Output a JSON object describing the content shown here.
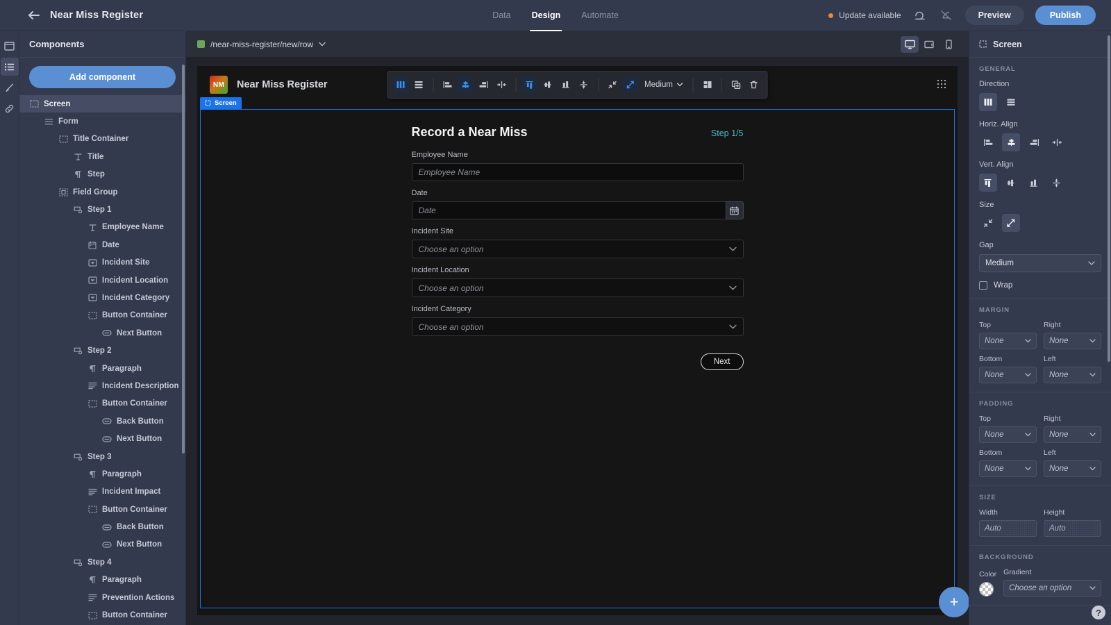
{
  "topbar": {
    "back_icon": "back-arrow-icon",
    "title": "Near Miss Register",
    "tabs": [
      {
        "label": "Data",
        "active": false
      },
      {
        "label": "Design",
        "active": true
      },
      {
        "label": "Automate",
        "active": false
      }
    ],
    "update_text": "Update available",
    "undo_icon": "undo-icon",
    "revert_icon": "revert-icon",
    "preview_label": "Preview",
    "publish_label": "Publish",
    "accent_blue": "#5b8fd4",
    "update_dot": "#e8883a"
  },
  "rail": {
    "items": [
      {
        "name": "screens-icon",
        "active": false
      },
      {
        "name": "components-list-icon",
        "active": true
      },
      {
        "name": "theme-brush-icon",
        "active": false
      },
      {
        "name": "bindings-link-icon",
        "active": false
      }
    ]
  },
  "left_panel": {
    "header": "Components",
    "add_button": "Add component",
    "tree": [
      {
        "label": "Screen",
        "depth": 0,
        "icon": "screen-icon",
        "selected": true
      },
      {
        "label": "Form",
        "depth": 1,
        "icon": "form-icon",
        "selected": false
      },
      {
        "label": "Title Container",
        "depth": 2,
        "icon": "container-icon",
        "selected": false
      },
      {
        "label": "Title",
        "depth": 3,
        "icon": "text-icon",
        "selected": false
      },
      {
        "label": "Step",
        "depth": 3,
        "icon": "paragraph-icon",
        "selected": false
      },
      {
        "label": "Field Group",
        "depth": 2,
        "icon": "field-group-icon",
        "selected": false
      },
      {
        "label": "Step 1",
        "depth": 3,
        "icon": "step-icon",
        "selected": false
      },
      {
        "label": "Employee Name",
        "depth": 4,
        "icon": "text-icon",
        "selected": false
      },
      {
        "label": "Date",
        "depth": 4,
        "icon": "date-icon",
        "selected": false
      },
      {
        "label": "Incident Site",
        "depth": 4,
        "icon": "select-icon",
        "selected": false
      },
      {
        "label": "Incident Location",
        "depth": 4,
        "icon": "select-icon",
        "selected": false
      },
      {
        "label": "Incident Category",
        "depth": 4,
        "icon": "select-icon",
        "selected": false
      },
      {
        "label": "Button Container",
        "depth": 4,
        "icon": "container-icon",
        "selected": false
      },
      {
        "label": "Next Button",
        "depth": 5,
        "icon": "button-icon",
        "selected": false
      },
      {
        "label": "Step 2",
        "depth": 3,
        "icon": "step-icon",
        "selected": false
      },
      {
        "label": "Paragraph",
        "depth": 4,
        "icon": "paragraph-icon",
        "selected": false
      },
      {
        "label": "Incident Description",
        "depth": 4,
        "icon": "textarea-icon",
        "selected": false
      },
      {
        "label": "Button Container",
        "depth": 4,
        "icon": "container-icon",
        "selected": false
      },
      {
        "label": "Back Button",
        "depth": 5,
        "icon": "button-icon",
        "selected": false
      },
      {
        "label": "Next Button",
        "depth": 5,
        "icon": "button-icon",
        "selected": false
      },
      {
        "label": "Step 3",
        "depth": 3,
        "icon": "step-icon",
        "selected": false
      },
      {
        "label": "Paragraph",
        "depth": 4,
        "icon": "paragraph-icon",
        "selected": false
      },
      {
        "label": "Incident Impact",
        "depth": 4,
        "icon": "textarea-icon",
        "selected": false
      },
      {
        "label": "Button Container",
        "depth": 4,
        "icon": "container-icon",
        "selected": false
      },
      {
        "label": "Back Button",
        "depth": 5,
        "icon": "button-icon",
        "selected": false
      },
      {
        "label": "Next Button",
        "depth": 5,
        "icon": "button-icon",
        "selected": false
      },
      {
        "label": "Step 4",
        "depth": 3,
        "icon": "step-icon",
        "selected": false
      },
      {
        "label": "Paragraph",
        "depth": 4,
        "icon": "paragraph-icon",
        "selected": false
      },
      {
        "label": "Prevention Actions",
        "depth": 4,
        "icon": "textarea-icon",
        "selected": false
      },
      {
        "label": "Button Container",
        "depth": 4,
        "icon": "container-icon",
        "selected": false
      }
    ]
  },
  "canvas_bar": {
    "route": "/near-miss-register/new/row",
    "devices": [
      {
        "name": "desktop-icon",
        "active": true
      },
      {
        "name": "tablet-icon",
        "active": false
      },
      {
        "name": "mobile-icon",
        "active": false
      }
    ]
  },
  "editor_toolbar": {
    "gap_value": "Medium",
    "buttons": [
      {
        "name": "direction-column-button",
        "on": true
      },
      {
        "name": "direction-row-button",
        "on": false
      },
      {
        "name": "halign-start-button",
        "on": false
      },
      {
        "name": "halign-center-button",
        "on": true
      },
      {
        "name": "halign-end-button",
        "on": false
      },
      {
        "name": "halign-space-between-button",
        "on": false
      },
      {
        "name": "valign-start-button",
        "on": true
      },
      {
        "name": "valign-center-button",
        "on": false
      },
      {
        "name": "valign-end-button",
        "on": false
      },
      {
        "name": "valign-space-between-button",
        "on": false
      },
      {
        "name": "size-shrink-button",
        "on": false
      },
      {
        "name": "size-grow-button",
        "on": true
      },
      {
        "name": "layout-button",
        "on": false
      },
      {
        "name": "duplicate-button",
        "on": false
      },
      {
        "name": "delete-button",
        "on": false
      }
    ]
  },
  "preview_app": {
    "logo_initials": "NM",
    "header_title": "Near Miss Register",
    "screen_tag": "Screen",
    "form": {
      "title": "Record a Near Miss",
      "step": "Step 1/5",
      "fields": [
        {
          "label": "Employee Name",
          "type": "text",
          "placeholder": "Employee Name",
          "value": ""
        },
        {
          "label": "Date",
          "type": "date",
          "placeholder": "Date",
          "value": ""
        },
        {
          "label": "Incident Site",
          "type": "select",
          "placeholder": "Choose an option",
          "value": ""
        },
        {
          "label": "Incident Location",
          "type": "select",
          "placeholder": "Choose an option",
          "value": ""
        },
        {
          "label": "Incident Category",
          "type": "select",
          "placeholder": "Choose an option",
          "value": ""
        }
      ],
      "next_label": "Next"
    },
    "fab_label": "+"
  },
  "right_panel": {
    "header": "Screen",
    "general": {
      "title": "GENERAL",
      "direction_label": "Direction",
      "direction_options": [
        {
          "name": "direction-column-option",
          "selected": true
        },
        {
          "name": "direction-row-option",
          "selected": false
        }
      ],
      "halign_label": "Horiz. Align",
      "halign_options": [
        {
          "name": "halign-start-option",
          "selected": false
        },
        {
          "name": "halign-center-option",
          "selected": true
        },
        {
          "name": "halign-end-option",
          "selected": false
        },
        {
          "name": "halign-space-between-option",
          "selected": false
        }
      ],
      "valign_label": "Vert. Align",
      "valign_options": [
        {
          "name": "valign-start-option",
          "selected": true
        },
        {
          "name": "valign-center-option",
          "selected": false
        },
        {
          "name": "valign-end-option",
          "selected": false
        },
        {
          "name": "valign-space-between-option",
          "selected": false
        }
      ],
      "size_label": "Size",
      "size_options": [
        {
          "name": "size-shrink-option",
          "selected": false
        },
        {
          "name": "size-grow-option",
          "selected": true
        }
      ],
      "gap_label": "Gap",
      "gap_value": "Medium",
      "wrap_label": "Wrap",
      "wrap_checked": false
    },
    "margin": {
      "title": "MARGIN",
      "top_label": "Top",
      "top_value": "None",
      "right_label": "Right",
      "right_value": "None",
      "bottom_label": "Bottom",
      "bottom_value": "None",
      "left_label": "Left",
      "left_value": "None"
    },
    "padding": {
      "title": "PADDING",
      "top_label": "Top",
      "top_value": "None",
      "right_label": "Right",
      "right_value": "None",
      "bottom_label": "Bottom",
      "bottom_value": "None",
      "left_label": "Left",
      "left_value": "None"
    },
    "size": {
      "title": "SIZE",
      "width_label": "Width",
      "width_value": "Auto",
      "height_label": "Height",
      "height_value": "Auto"
    },
    "background": {
      "title": "BACKGROUND",
      "color_label": "Color",
      "gradient_label": "Gradient",
      "gradient_value": "Choose an option"
    },
    "help_label": "?"
  }
}
